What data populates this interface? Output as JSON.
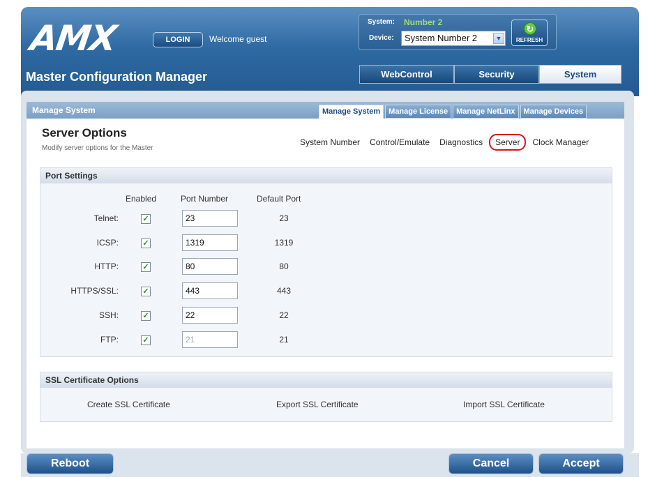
{
  "header": {
    "logo": "AMX",
    "login_label": "LOGIN",
    "welcome": "Welcome guest",
    "system_label": "System:",
    "system_value": "Number 2",
    "device_label": "Device:",
    "device_selected": "System Number 2",
    "refresh_label": "REFRESH",
    "app_title": "Master Configuration Manager",
    "tabs": [
      {
        "label": "WebControl"
      },
      {
        "label": "Security"
      },
      {
        "label": "System"
      }
    ]
  },
  "panel": {
    "title": "Manage System",
    "sub_tabs": [
      {
        "label": "Manage System"
      },
      {
        "label": "Manage License"
      },
      {
        "label": "Manage NetLinx"
      },
      {
        "label": "Manage Devices"
      }
    ],
    "section_title": "Server Options",
    "section_subtitle": "Modify server options for the Master",
    "sub_nav": [
      {
        "label": "System Number"
      },
      {
        "label": "Control/Emulate"
      },
      {
        "label": "Diagnostics"
      },
      {
        "label": "Server"
      },
      {
        "label": "Clock Manager"
      }
    ]
  },
  "port_settings": {
    "title": "Port Settings",
    "col_enabled": "Enabled",
    "col_port": "Port Number",
    "col_default": "Default Port",
    "rows": [
      {
        "label": "Telnet:",
        "enabled": true,
        "port": "23",
        "default": "23"
      },
      {
        "label": "ICSP:",
        "enabled": true,
        "port": "1319",
        "default": "1319"
      },
      {
        "label": "HTTP:",
        "enabled": true,
        "port": "80",
        "default": "80"
      },
      {
        "label": "HTTPS/SSL:",
        "enabled": true,
        "port": "443",
        "default": "443"
      },
      {
        "label": "SSH:",
        "enabled": true,
        "port": "22",
        "default": "22"
      },
      {
        "label": "FTP:",
        "enabled": true,
        "port": "21",
        "default": "21"
      }
    ]
  },
  "ssl": {
    "title": "SSL Certificate Options",
    "create": "Create SSL Certificate",
    "export": "Export SSL Certificate",
    "import": "Import SSL Certificate"
  },
  "footer": {
    "reboot": "Reboot",
    "cancel": "Cancel",
    "accept": "Accept"
  },
  "icons": {
    "refresh": "refresh-icon",
    "check": "✓",
    "dropdown": "▼"
  }
}
